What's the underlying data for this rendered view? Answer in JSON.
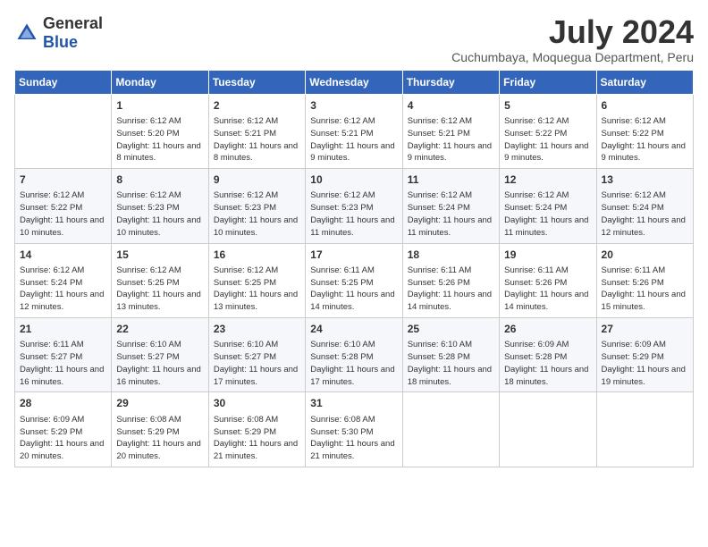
{
  "logo": {
    "general": "General",
    "blue": "Blue"
  },
  "title": {
    "month_year": "July 2024",
    "location": "Cuchumbaya, Moquegua Department, Peru"
  },
  "days_of_week": [
    "Sunday",
    "Monday",
    "Tuesday",
    "Wednesday",
    "Thursday",
    "Friday",
    "Saturday"
  ],
  "weeks": [
    [
      {
        "day": "",
        "sunrise": "",
        "sunset": "",
        "daylight": ""
      },
      {
        "day": "1",
        "sunrise": "Sunrise: 6:12 AM",
        "sunset": "Sunset: 5:20 PM",
        "daylight": "Daylight: 11 hours and 8 minutes."
      },
      {
        "day": "2",
        "sunrise": "Sunrise: 6:12 AM",
        "sunset": "Sunset: 5:21 PM",
        "daylight": "Daylight: 11 hours and 8 minutes."
      },
      {
        "day": "3",
        "sunrise": "Sunrise: 6:12 AM",
        "sunset": "Sunset: 5:21 PM",
        "daylight": "Daylight: 11 hours and 9 minutes."
      },
      {
        "day": "4",
        "sunrise": "Sunrise: 6:12 AM",
        "sunset": "Sunset: 5:21 PM",
        "daylight": "Daylight: 11 hours and 9 minutes."
      },
      {
        "day": "5",
        "sunrise": "Sunrise: 6:12 AM",
        "sunset": "Sunset: 5:22 PM",
        "daylight": "Daylight: 11 hours and 9 minutes."
      },
      {
        "day": "6",
        "sunrise": "Sunrise: 6:12 AM",
        "sunset": "Sunset: 5:22 PM",
        "daylight": "Daylight: 11 hours and 9 minutes."
      }
    ],
    [
      {
        "day": "7",
        "sunrise": "Sunrise: 6:12 AM",
        "sunset": "Sunset: 5:22 PM",
        "daylight": "Daylight: 11 hours and 10 minutes."
      },
      {
        "day": "8",
        "sunrise": "Sunrise: 6:12 AM",
        "sunset": "Sunset: 5:23 PM",
        "daylight": "Daylight: 11 hours and 10 minutes."
      },
      {
        "day": "9",
        "sunrise": "Sunrise: 6:12 AM",
        "sunset": "Sunset: 5:23 PM",
        "daylight": "Daylight: 11 hours and 10 minutes."
      },
      {
        "day": "10",
        "sunrise": "Sunrise: 6:12 AM",
        "sunset": "Sunset: 5:23 PM",
        "daylight": "Daylight: 11 hours and 11 minutes."
      },
      {
        "day": "11",
        "sunrise": "Sunrise: 6:12 AM",
        "sunset": "Sunset: 5:24 PM",
        "daylight": "Daylight: 11 hours and 11 minutes."
      },
      {
        "day": "12",
        "sunrise": "Sunrise: 6:12 AM",
        "sunset": "Sunset: 5:24 PM",
        "daylight": "Daylight: 11 hours and 11 minutes."
      },
      {
        "day": "13",
        "sunrise": "Sunrise: 6:12 AM",
        "sunset": "Sunset: 5:24 PM",
        "daylight": "Daylight: 11 hours and 12 minutes."
      }
    ],
    [
      {
        "day": "14",
        "sunrise": "Sunrise: 6:12 AM",
        "sunset": "Sunset: 5:24 PM",
        "daylight": "Daylight: 11 hours and 12 minutes."
      },
      {
        "day": "15",
        "sunrise": "Sunrise: 6:12 AM",
        "sunset": "Sunset: 5:25 PM",
        "daylight": "Daylight: 11 hours and 13 minutes."
      },
      {
        "day": "16",
        "sunrise": "Sunrise: 6:12 AM",
        "sunset": "Sunset: 5:25 PM",
        "daylight": "Daylight: 11 hours and 13 minutes."
      },
      {
        "day": "17",
        "sunrise": "Sunrise: 6:11 AM",
        "sunset": "Sunset: 5:25 PM",
        "daylight": "Daylight: 11 hours and 14 minutes."
      },
      {
        "day": "18",
        "sunrise": "Sunrise: 6:11 AM",
        "sunset": "Sunset: 5:26 PM",
        "daylight": "Daylight: 11 hours and 14 minutes."
      },
      {
        "day": "19",
        "sunrise": "Sunrise: 6:11 AM",
        "sunset": "Sunset: 5:26 PM",
        "daylight": "Daylight: 11 hours and 14 minutes."
      },
      {
        "day": "20",
        "sunrise": "Sunrise: 6:11 AM",
        "sunset": "Sunset: 5:26 PM",
        "daylight": "Daylight: 11 hours and 15 minutes."
      }
    ],
    [
      {
        "day": "21",
        "sunrise": "Sunrise: 6:11 AM",
        "sunset": "Sunset: 5:27 PM",
        "daylight": "Daylight: 11 hours and 16 minutes."
      },
      {
        "day": "22",
        "sunrise": "Sunrise: 6:10 AM",
        "sunset": "Sunset: 5:27 PM",
        "daylight": "Daylight: 11 hours and 16 minutes."
      },
      {
        "day": "23",
        "sunrise": "Sunrise: 6:10 AM",
        "sunset": "Sunset: 5:27 PM",
        "daylight": "Daylight: 11 hours and 17 minutes."
      },
      {
        "day": "24",
        "sunrise": "Sunrise: 6:10 AM",
        "sunset": "Sunset: 5:28 PM",
        "daylight": "Daylight: 11 hours and 17 minutes."
      },
      {
        "day": "25",
        "sunrise": "Sunrise: 6:10 AM",
        "sunset": "Sunset: 5:28 PM",
        "daylight": "Daylight: 11 hours and 18 minutes."
      },
      {
        "day": "26",
        "sunrise": "Sunrise: 6:09 AM",
        "sunset": "Sunset: 5:28 PM",
        "daylight": "Daylight: 11 hours and 18 minutes."
      },
      {
        "day": "27",
        "sunrise": "Sunrise: 6:09 AM",
        "sunset": "Sunset: 5:29 PM",
        "daylight": "Daylight: 11 hours and 19 minutes."
      }
    ],
    [
      {
        "day": "28",
        "sunrise": "Sunrise: 6:09 AM",
        "sunset": "Sunset: 5:29 PM",
        "daylight": "Daylight: 11 hours and 20 minutes."
      },
      {
        "day": "29",
        "sunrise": "Sunrise: 6:08 AM",
        "sunset": "Sunset: 5:29 PM",
        "daylight": "Daylight: 11 hours and 20 minutes."
      },
      {
        "day": "30",
        "sunrise": "Sunrise: 6:08 AM",
        "sunset": "Sunset: 5:29 PM",
        "daylight": "Daylight: 11 hours and 21 minutes."
      },
      {
        "day": "31",
        "sunrise": "Sunrise: 6:08 AM",
        "sunset": "Sunset: 5:30 PM",
        "daylight": "Daylight: 11 hours and 21 minutes."
      },
      {
        "day": "",
        "sunrise": "",
        "sunset": "",
        "daylight": ""
      },
      {
        "day": "",
        "sunrise": "",
        "sunset": "",
        "daylight": ""
      },
      {
        "day": "",
        "sunrise": "",
        "sunset": "",
        "daylight": ""
      }
    ]
  ]
}
